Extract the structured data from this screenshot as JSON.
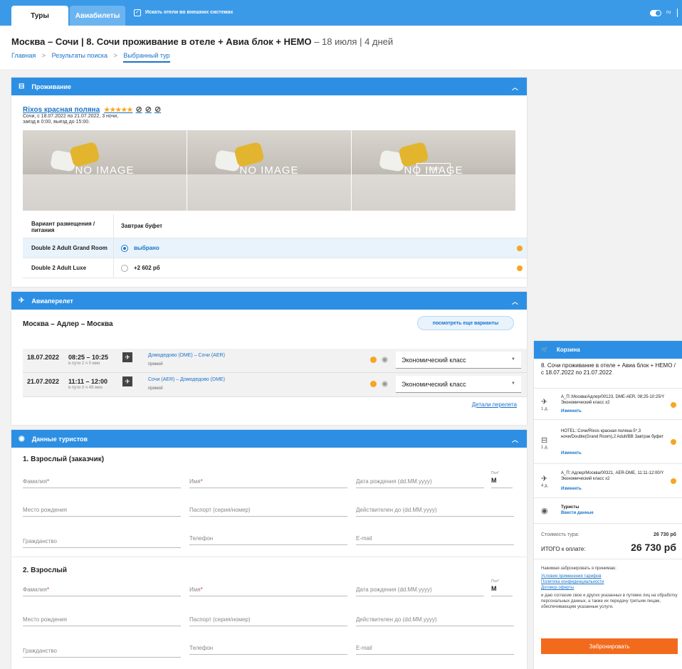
{
  "topbar": {
    "tab_tours": "Туры",
    "tab_flights": "Авиабилеты",
    "search_external_label": "Искать отели во внешних системах",
    "lang": "ru"
  },
  "header": {
    "title_main": "Москва – Сочи | 8. Сочи проживание в отеле + Авиа блок + НЕМО",
    "title_sub": " – 18 июля | 4 дней",
    "breadcrumbs": [
      "Главная",
      "Результаты поиска",
      "Выбранный тур"
    ],
    "breadcrumb_sep": ">"
  },
  "accommodation": {
    "heading": "Проживание",
    "hotel_name": "Rixos красная поляна",
    "stars": "★★★★★",
    "restriction_icons": [
      "⊘",
      "⊘",
      "⊘"
    ],
    "info_line1": "Сочи, с 18.07.2022 по 21.07.2022, 3 ночи,",
    "info_line2": "заезд в 0:00, выезд до 15:00.",
    "no_image": "NO IMAGE",
    "more_photos": "+2 Фото",
    "table_head_c1": "Вариант размещения / питания",
    "table_head_c2": "Завтрак буфет",
    "rooms": [
      {
        "name": "Double 2 Adult Grand Room",
        "value": "выбрано",
        "selected": true
      },
      {
        "name": "Double 2 Adult Luxe",
        "value": "+2 602 рб",
        "selected": false
      }
    ]
  },
  "flight": {
    "heading": "Авиаперелет",
    "route": "Москва – Адлер – Москва",
    "more_variants": "посмотреть еще варианты",
    "segments": [
      {
        "date": "18.07.2022",
        "time": "08:25 – 10:25",
        "duration": "в пути 2 ч 0 мин",
        "airports": "Домодедово (DME) – Сочи (AER)",
        "direct": "прямой",
        "class": "Экономический класс"
      },
      {
        "date": "21.07.2022",
        "time": "11:11 – 12:00",
        "duration": "в пути 0 ч 49 мин",
        "airports": "Сочи (AER) – Домодедово (DME)",
        "direct": "прямой",
        "class": "Экономический класс"
      }
    ],
    "details_link": "Детали перелета"
  },
  "tourists": {
    "heading": "Данные туристов",
    "people": [
      {
        "title": "1. Взрослый (заказчик)"
      },
      {
        "title": "2. Взрослый"
      }
    ],
    "labels": {
      "lastname": "Фамилия",
      "firstname": "Имя",
      "birthdate": "Дата рождения (dd.MM.yyyy)",
      "gender": "Пол",
      "gender_value": "M",
      "birthplace": "Место рождения",
      "passport": "Паспорт (серия/номер)",
      "valid_until": "Действителен до (dd.MM.yyyy)",
      "citizenship": "Гражданство",
      "phone": "Телефон",
      "email": "E-mail",
      "required": "*"
    }
  },
  "cart": {
    "heading": "Корзина",
    "title": "8. Сочи проживание в отеле + Авиа блок + НЕМО / с 18.07.2022 по 21.07.2022",
    "items": [
      {
        "icon": "plane-icon",
        "days": "1 д.",
        "text": "А_П::Москва/Адлер/00123, DME-AER, 08:25-10:25/Y Экономический класс x2",
        "link": "Изменить"
      },
      {
        "icon": "hotel-icon",
        "days": "1 д.",
        "text": "HOTEL::Сочи/Rixos красная поляна-5*,3 ночи/Double(Grand Room),2 Adult/BB Завтрак буфет",
        "link": "Изменить"
      },
      {
        "icon": "plane-icon",
        "days": "4 д.",
        "text": "А_П::Адлер/Москва/00321, AER-DME, 11:11-12:00/Y Экономический класс x2",
        "link": "Изменить"
      }
    ],
    "tourists_label": "Туристы",
    "tourists_link": "Ввести данные",
    "cost_label": "Стоимость тура:",
    "cost_value": "26 730 рб",
    "total_label": "ИТОГО к оплате:",
    "total_value": "26 730 рб",
    "agree_intro": "Нажимая забронировать я принимаю:",
    "agree_links": [
      "Условия применения тарифов",
      "Политика конфиденциальности",
      "Договор оферты"
    ],
    "agree_text": "и даю согласие свое и других указанных в путевке лиц на обработку персональных данных, а также их передачу третьим лицам, обеспечивающим указанные услуги.",
    "book_button": "Забронировать"
  }
}
